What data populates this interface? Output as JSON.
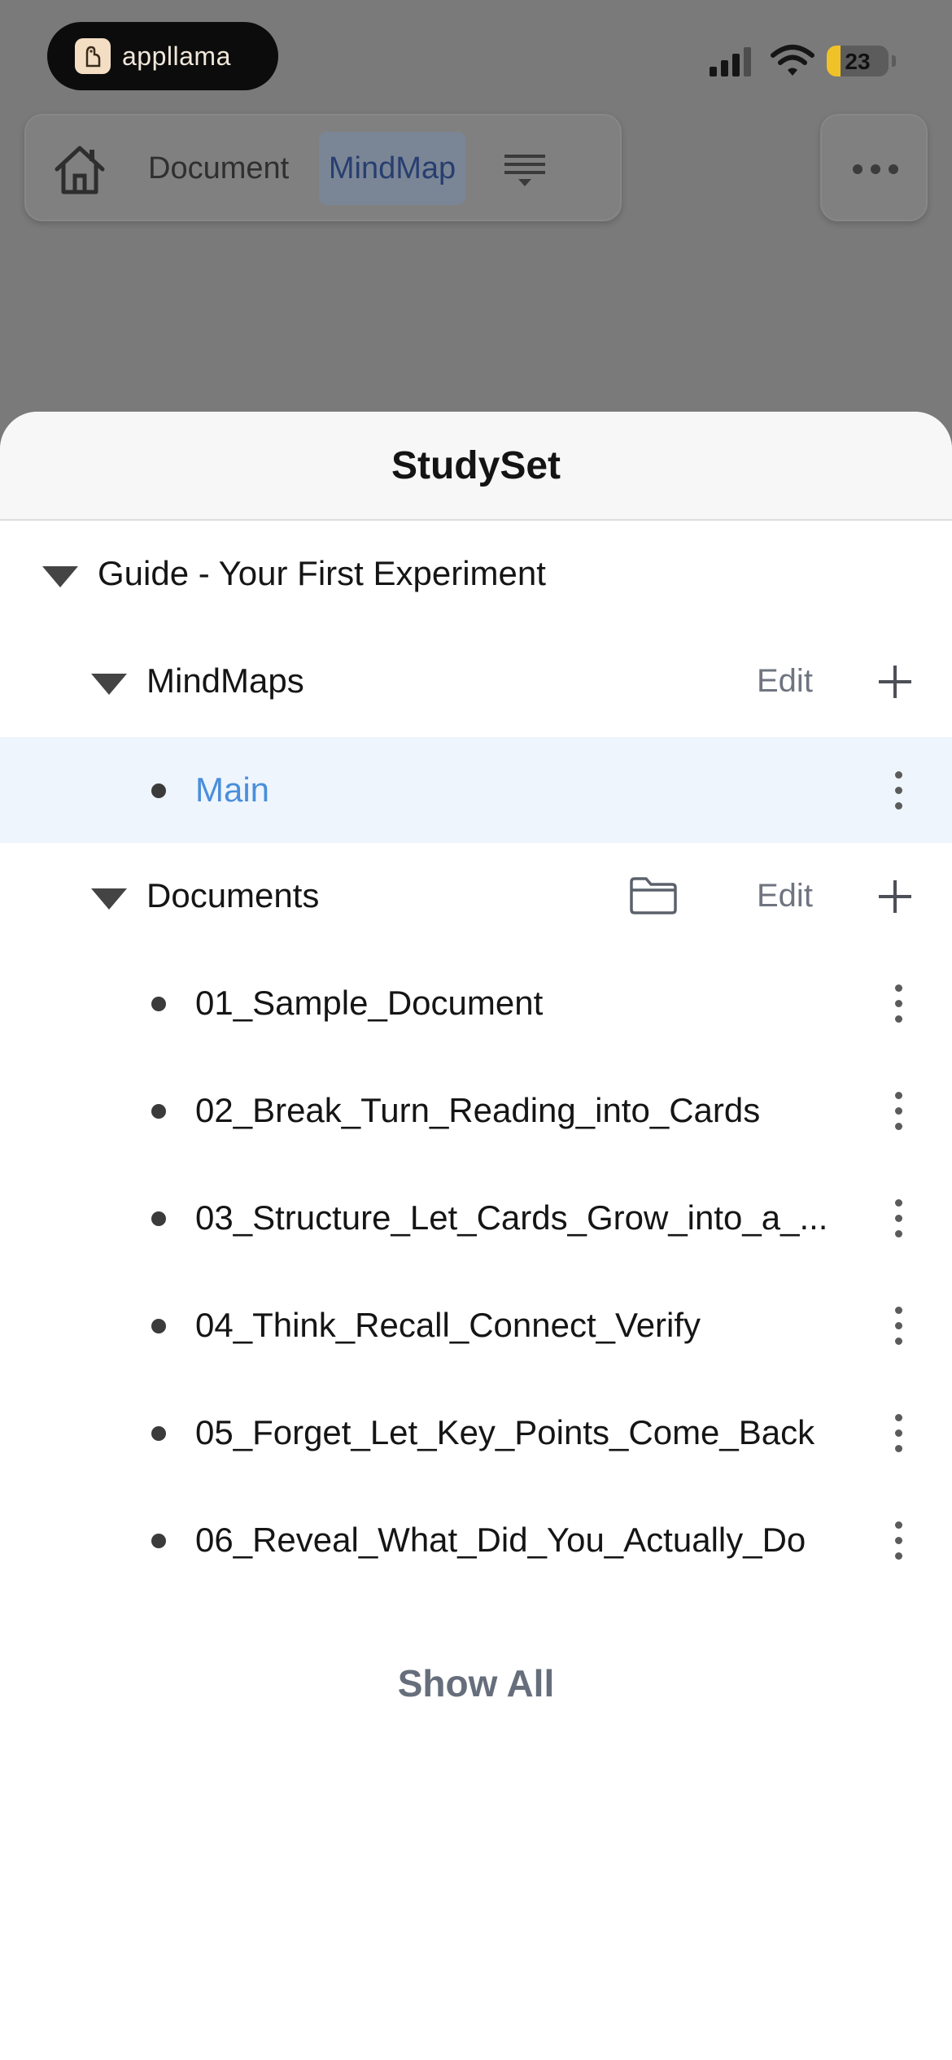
{
  "status_bar": {
    "app_badge_name": "appllama",
    "battery_level": "23",
    "battery_fraction": 0.23
  },
  "toolbar": {
    "tab_document": "Document",
    "tab_mindmap": "MindMap",
    "active_tab": "MindMap"
  },
  "sheet": {
    "title": "StudySet",
    "set_name": "Guide - Your First Experiment",
    "mindmaps": {
      "label": "MindMaps",
      "edit_label": "Edit",
      "items": [
        {
          "label": "Main",
          "selected": true
        }
      ]
    },
    "documents": {
      "label": "Documents",
      "edit_label": "Edit",
      "items": [
        {
          "label": "01_Sample_Document"
        },
        {
          "label": "02_Break_Turn_Reading_into_Cards"
        },
        {
          "label": "03_Structure_Let_Cards_Grow_into_a_..."
        },
        {
          "label": "04_Think_Recall_Connect_Verify"
        },
        {
          "label": "05_Forget_Let_Key_Points_Come_Back"
        },
        {
          "label": "06_Reveal_What_Did_You_Actually_Do"
        }
      ]
    },
    "show_all_label": "Show All"
  },
  "colors": {
    "accent_blue": "#4a8edb",
    "selected_row_bg": "#eef5fd",
    "battery_yellow": "#f0c22a"
  }
}
